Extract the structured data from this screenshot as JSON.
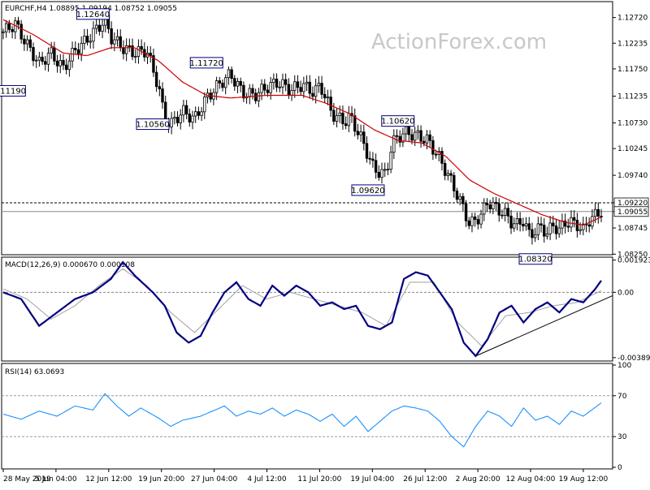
{
  "header": {
    "title": "EURCHF,H4  1.08895 1.09194 1.08752 1.09055",
    "watermark": "ActionForex.com"
  },
  "colors": {
    "candle": "#000000",
    "ma": "#cc0000",
    "macd_line": "#000080",
    "macd_signal": "#a0a0a0",
    "rsi_line": "#1e90ff",
    "level_line": "#000000",
    "price_box_bg": "#ffffff",
    "price_box_text": "#000080"
  },
  "chart_data": [
    {
      "type": "candlestick",
      "title": "EURCHF,H4  1.08895 1.09194 1.08752 1.09055",
      "ylim": [
        1.0827,
        1.1299
      ],
      "y_ticks": [
        "1.12720",
        "1.12235",
        "1.11750",
        "1.11235",
        "1.10730",
        "1.10245",
        "1.09740",
        "1.09220",
        "1.09055",
        "1.08745",
        "1.08250"
      ],
      "x_ticks": [
        "28 May 2019",
        "5 Jun 04:00",
        "12 Jun 12:00",
        "19 Jun 20:00",
        "27 Jun 04:00",
        "4 Jul 12:00",
        "11 Jul 20:00",
        "19 Jul 04:00",
        "26 Jul 12:00",
        "2 Aug 20:00",
        "12 Aug 04:00",
        "19 Aug 12:00"
      ],
      "annotations": [
        {
          "label": "1.12640",
          "x": 0.15,
          "y": 1.1264
        },
        {
          "label": "1.11720",
          "x": 0.34,
          "y": 1.1172
        },
        {
          "label": "1.11190",
          "x": 0.01,
          "y": 1.1119
        },
        {
          "label": "1.10560",
          "x": 0.25,
          "y": 1.1056
        },
        {
          "label": "1.10620",
          "x": 0.66,
          "y": 1.1062
        },
        {
          "label": "1.09620",
          "x": 0.61,
          "y": 1.0962
        },
        {
          "label": "1.08320",
          "x": 0.89,
          "y": 1.0832
        }
      ],
      "current_price": 1.09055,
      "reference_level": 1.0922,
      "price_key_points": [
        [
          0.0,
          1.1245
        ],
        [
          0.02,
          1.126
        ],
        [
          0.04,
          1.122
        ],
        [
          0.06,
          1.1185
        ],
        [
          0.08,
          1.1205
        ],
        [
          0.1,
          1.1175
        ],
        [
          0.12,
          1.121
        ],
        [
          0.14,
          1.123
        ],
        [
          0.16,
          1.1255
        ],
        [
          0.17,
          1.1268
        ],
        [
          0.18,
          1.1235
        ],
        [
          0.2,
          1.1215
        ],
        [
          0.22,
          1.1205
        ],
        [
          0.24,
          1.121
        ],
        [
          0.26,
          1.114
        ],
        [
          0.27,
          1.108
        ],
        [
          0.28,
          1.107
        ],
        [
          0.3,
          1.1095
        ],
        [
          0.32,
          1.108
        ],
        [
          0.34,
          1.112
        ],
        [
          0.36,
          1.1145
        ],
        [
          0.38,
          1.1165
        ],
        [
          0.4,
          1.113
        ],
        [
          0.42,
          1.1125
        ],
        [
          0.44,
          1.114
        ],
        [
          0.46,
          1.115
        ],
        [
          0.48,
          1.1135
        ],
        [
          0.5,
          1.1145
        ],
        [
          0.52,
          1.113
        ],
        [
          0.53,
          1.1145
        ],
        [
          0.55,
          1.109
        ],
        [
          0.57,
          1.1075
        ],
        [
          0.58,
          1.1085
        ],
        [
          0.6,
          1.104
        ],
        [
          0.62,
          1.0985
        ],
        [
          0.64,
          1.0975
        ],
        [
          0.65,
          1.1035
        ],
        [
          0.67,
          1.1055
        ],
        [
          0.69,
          1.105
        ],
        [
          0.71,
          1.104
        ],
        [
          0.73,
          1.1005
        ],
        [
          0.75,
          1.096
        ],
        [
          0.77,
          1.091
        ],
        [
          0.78,
          1.088
        ],
        [
          0.8,
          1.09
        ],
        [
          0.81,
          1.0925
        ],
        [
          0.82,
          1.0915
        ],
        [
          0.84,
          1.09
        ],
        [
          0.85,
          1.0885
        ],
        [
          0.86,
          1.088
        ],
        [
          0.87,
          1.089
        ],
        [
          0.88,
          1.086
        ],
        [
          0.89,
          1.087
        ],
        [
          0.9,
          1.0875
        ],
        [
          0.91,
          1.0865
        ],
        [
          0.92,
          1.088
        ],
        [
          0.93,
          1.087
        ],
        [
          0.94,
          1.0885
        ],
        [
          0.95,
          1.0885
        ],
        [
          0.96,
          1.088
        ],
        [
          0.97,
          1.087
        ],
        [
          0.98,
          1.089
        ],
        [
          1.0,
          1.0906
        ]
      ],
      "ma_key_points": [
        [
          0.0,
          1.1268
        ],
        [
          0.05,
          1.124
        ],
        [
          0.1,
          1.1205
        ],
        [
          0.14,
          1.12
        ],
        [
          0.18,
          1.1215
        ],
        [
          0.22,
          1.1215
        ],
        [
          0.26,
          1.119
        ],
        [
          0.3,
          1.115
        ],
        [
          0.34,
          1.1125
        ],
        [
          0.38,
          1.112
        ],
        [
          0.44,
          1.1125
        ],
        [
          0.5,
          1.1125
        ],
        [
          0.54,
          1.111
        ],
        [
          0.58,
          1.109
        ],
        [
          0.62,
          1.106
        ],
        [
          0.66,
          1.104
        ],
        [
          0.7,
          1.1035
        ],
        [
          0.74,
          1.101
        ],
        [
          0.78,
          1.0965
        ],
        [
          0.82,
          1.094
        ],
        [
          0.86,
          1.092
        ],
        [
          0.9,
          1.09
        ],
        [
          0.94,
          1.0885
        ],
        [
          0.97,
          1.088
        ],
        [
          1.0,
          1.0895
        ]
      ]
    },
    {
      "type": "line",
      "title": "MACD(12,26,9) 0.000670 0.000108",
      "ylim": [
        -0.004,
        0.002
      ],
      "y_ticks": [
        "0.001923",
        "0.00",
        "-0.003896"
      ],
      "series": [
        {
          "name": "MACD",
          "key_points": [
            [
              0.0,
              0.0
            ],
            [
              0.03,
              -0.0004
            ],
            [
              0.06,
              -0.002
            ],
            [
              0.09,
              -0.0012
            ],
            [
              0.12,
              -0.0004
            ],
            [
              0.15,
              0.0
            ],
            [
              0.18,
              0.0008
            ],
            [
              0.2,
              0.0018
            ],
            [
              0.22,
              0.001
            ],
            [
              0.25,
              0.0
            ],
            [
              0.27,
              -0.0008
            ],
            [
              0.29,
              -0.0024
            ],
            [
              0.31,
              -0.003
            ],
            [
              0.33,
              -0.0026
            ],
            [
              0.35,
              -0.0012
            ],
            [
              0.37,
              0.0
            ],
            [
              0.39,
              0.0006
            ],
            [
              0.41,
              -0.0004
            ],
            [
              0.43,
              -0.0008
            ],
            [
              0.45,
              0.0004
            ],
            [
              0.47,
              -0.0002
            ],
            [
              0.49,
              0.0004
            ],
            [
              0.51,
              0.0
            ],
            [
              0.53,
              -0.0008
            ],
            [
              0.55,
              -0.0006
            ],
            [
              0.57,
              -0.001
            ],
            [
              0.59,
              -0.0008
            ],
            [
              0.61,
              -0.002
            ],
            [
              0.63,
              -0.0022
            ],
            [
              0.65,
              -0.0018
            ],
            [
              0.67,
              0.0008
            ],
            [
              0.69,
              0.0012
            ],
            [
              0.71,
              0.001
            ],
            [
              0.73,
              0.0
            ],
            [
              0.75,
              -0.001
            ],
            [
              0.77,
              -0.003
            ],
            [
              0.79,
              -0.0038
            ],
            [
              0.81,
              -0.0028
            ],
            [
              0.83,
              -0.0012
            ],
            [
              0.85,
              -0.0008
            ],
            [
              0.87,
              -0.0018
            ],
            [
              0.89,
              -0.001
            ],
            [
              0.91,
              -0.0006
            ],
            [
              0.93,
              -0.0012
            ],
            [
              0.95,
              -0.0004
            ],
            [
              0.97,
              -0.0006
            ],
            [
              0.99,
              0.0002
            ],
            [
              1.0,
              0.0007
            ]
          ]
        },
        {
          "name": "Signal",
          "key_points": [
            [
              0.0,
              0.0002
            ],
            [
              0.04,
              -0.0004
            ],
            [
              0.08,
              -0.0016
            ],
            [
              0.12,
              -0.0008
            ],
            [
              0.16,
              0.0004
            ],
            [
              0.2,
              0.0014
            ],
            [
              0.24,
              0.0004
            ],
            [
              0.28,
              -0.0012
            ],
            [
              0.32,
              -0.0024
            ],
            [
              0.36,
              -0.001
            ],
            [
              0.4,
              0.0004
            ],
            [
              0.44,
              -0.0004
            ],
            [
              0.48,
              0.0
            ],
            [
              0.52,
              -0.0004
            ],
            [
              0.56,
              -0.0008
            ],
            [
              0.6,
              -0.0012
            ],
            [
              0.64,
              -0.002
            ],
            [
              0.68,
              0.0006
            ],
            [
              0.72,
              0.0006
            ],
            [
              0.76,
              -0.0018
            ],
            [
              0.8,
              -0.0032
            ],
            [
              0.84,
              -0.0014
            ],
            [
              0.88,
              -0.0012
            ],
            [
              0.92,
              -0.0008
            ],
            [
              0.96,
              -0.0006
            ],
            [
              1.0,
              0.0001
            ]
          ]
        }
      ]
    },
    {
      "type": "line",
      "title": "RSI(14) 63.0693",
      "ylim": [
        0,
        100
      ],
      "y_ticks": [
        "100",
        "70",
        "30",
        "0"
      ],
      "levels": [
        70,
        30
      ],
      "series": [
        {
          "name": "RSI",
          "key_points": [
            [
              0.0,
              52
            ],
            [
              0.03,
              47
            ],
            [
              0.06,
              55
            ],
            [
              0.09,
              50
            ],
            [
              0.12,
              60
            ],
            [
              0.15,
              56
            ],
            [
              0.17,
              72
            ],
            [
              0.19,
              60
            ],
            [
              0.21,
              50
            ],
            [
              0.23,
              58
            ],
            [
              0.26,
              48
            ],
            [
              0.28,
              40
            ],
            [
              0.3,
              46
            ],
            [
              0.33,
              50
            ],
            [
              0.35,
              55
            ],
            [
              0.37,
              60
            ],
            [
              0.39,
              50
            ],
            [
              0.41,
              55
            ],
            [
              0.43,
              52
            ],
            [
              0.45,
              58
            ],
            [
              0.47,
              50
            ],
            [
              0.49,
              56
            ],
            [
              0.51,
              52
            ],
            [
              0.53,
              45
            ],
            [
              0.55,
              52
            ],
            [
              0.57,
              40
            ],
            [
              0.59,
              50
            ],
            [
              0.61,
              35
            ],
            [
              0.63,
              45
            ],
            [
              0.65,
              55
            ],
            [
              0.67,
              60
            ],
            [
              0.69,
              58
            ],
            [
              0.71,
              55
            ],
            [
              0.73,
              45
            ],
            [
              0.75,
              30
            ],
            [
              0.77,
              20
            ],
            [
              0.79,
              40
            ],
            [
              0.81,
              55
            ],
            [
              0.83,
              50
            ],
            [
              0.85,
              40
            ],
            [
              0.87,
              58
            ],
            [
              0.89,
              46
            ],
            [
              0.91,
              50
            ],
            [
              0.93,
              42
            ],
            [
              0.95,
              55
            ],
            [
              0.97,
              50
            ],
            [
              1.0,
              63
            ]
          ]
        }
      ]
    }
  ]
}
